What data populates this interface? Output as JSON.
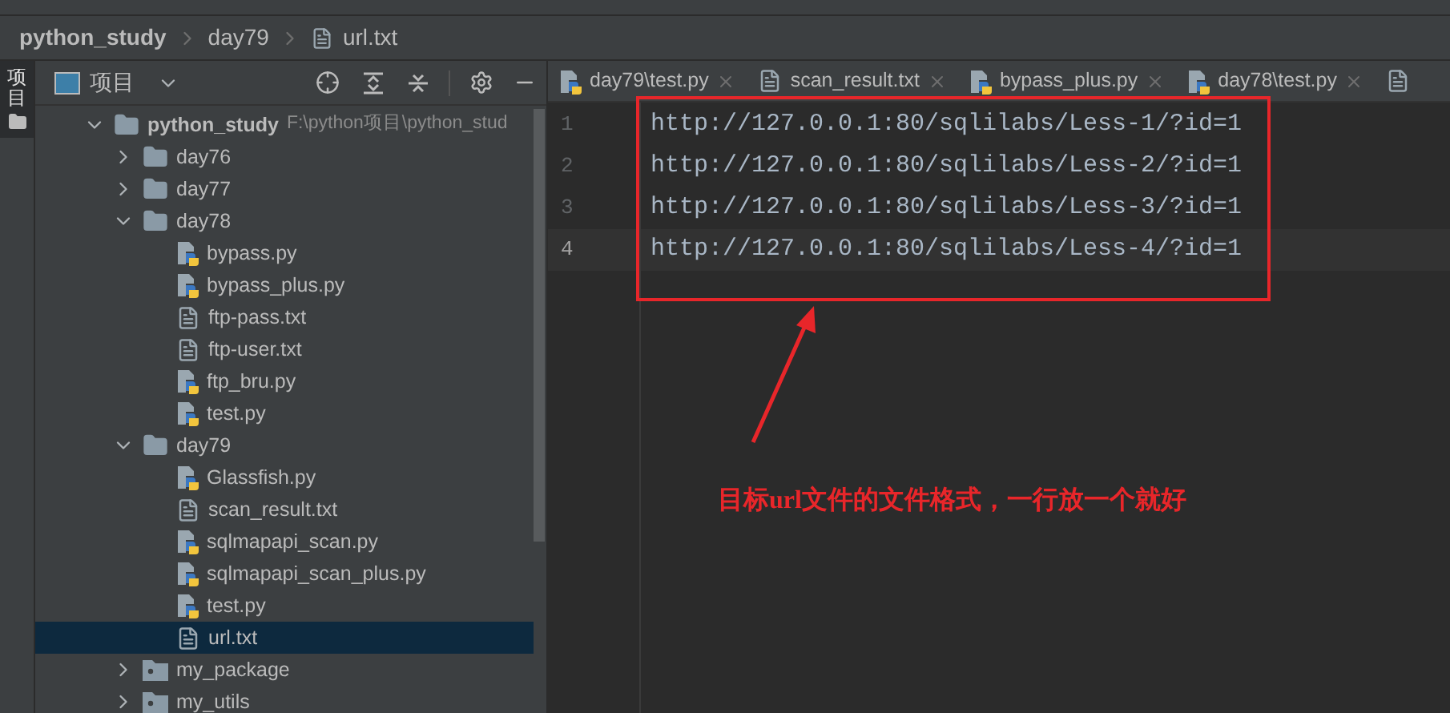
{
  "breadcrumb": [
    "python_study",
    "day79",
    "url.txt"
  ],
  "side_strip": {
    "label": "项目",
    "selected": true
  },
  "project_panel": {
    "title": "项目"
  },
  "tree": [
    {
      "name": "python_study",
      "path": "F:\\python项目\\python_stud",
      "kind": "folder",
      "expanded": true,
      "selected": false,
      "children": [
        {
          "name": "day76",
          "kind": "folder",
          "expanded": false,
          "selected": false
        },
        {
          "name": "day77",
          "kind": "folder",
          "expanded": false,
          "selected": false
        },
        {
          "name": "day78",
          "kind": "folder",
          "expanded": true,
          "selected": false,
          "children": [
            {
              "name": "bypass.py",
              "kind": "python",
              "selected": false
            },
            {
              "name": "bypass_plus.py",
              "kind": "python",
              "selected": false
            },
            {
              "name": "ftp-pass.txt",
              "kind": "text",
              "selected": false
            },
            {
              "name": "ftp-user.txt",
              "kind": "text",
              "selected": false
            },
            {
              "name": "ftp_bru.py",
              "kind": "python",
              "selected": false
            },
            {
              "name": "test.py",
              "kind": "python",
              "selected": false
            }
          ]
        },
        {
          "name": "day79",
          "kind": "folder",
          "expanded": true,
          "selected": false,
          "children": [
            {
              "name": "Glassfish.py",
              "kind": "python",
              "selected": false
            },
            {
              "name": "scan_result.txt",
              "kind": "text",
              "selected": false
            },
            {
              "name": "sqlmapapi_scan.py",
              "kind": "python",
              "selected": false
            },
            {
              "name": "sqlmapapi_scan_plus.py",
              "kind": "python",
              "selected": false
            },
            {
              "name": "test.py",
              "kind": "python",
              "selected": false
            },
            {
              "name": "url.txt",
              "kind": "text",
              "selected": true
            }
          ]
        },
        {
          "name": "my_package",
          "kind": "package",
          "expanded": false,
          "selected": false
        },
        {
          "name": "my_utils",
          "kind": "package",
          "expanded": false,
          "selected": false
        }
      ]
    }
  ],
  "tabs": [
    {
      "label": "day79\\test.py",
      "kind": "python"
    },
    {
      "label": "scan_result.txt",
      "kind": "text"
    },
    {
      "label": "bypass_plus.py",
      "kind": "python"
    },
    {
      "label": "day78\\test.py",
      "kind": "python"
    },
    {
      "kind": "text"
    }
  ],
  "code_lines": [
    {
      "number": "1",
      "text": "http://127.0.0.1:80/sqlilabs/Less-1/?id=1",
      "current": false
    },
    {
      "number": "2",
      "text": "http://127.0.0.1:80/sqlilabs/Less-2/?id=1",
      "current": false
    },
    {
      "number": "3",
      "text": "http://127.0.0.1:80/sqlilabs/Less-3/?id=1",
      "current": false
    },
    {
      "number": "4",
      "text": "http://127.0.0.1:80/sqlilabs/Less-4/?id=1",
      "current": true
    }
  ],
  "annotation": {
    "text": "目标url文件的文件格式，一行放一个就好"
  }
}
